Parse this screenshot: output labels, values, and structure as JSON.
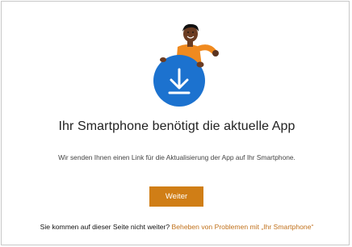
{
  "dialog": {
    "title": "Ihr Smartphone benötigt die aktuelle App",
    "subtitle": "Wir senden Ihnen einen Link für die Aktualisierung der App auf Ihr Smartphone.",
    "primary_button_label": "Weiter",
    "footer_text": "Sie kommen auf dieser Seite nicht weiter?",
    "footer_link_text": "Beheben von Problemen mit „Ihr Smartphone“",
    "illustration_icon": "download-arrow-icon"
  },
  "colors": {
    "accent_button": "#d07e16",
    "link": "#c0701a",
    "circle_blue": "#1c72cf",
    "person_shirt": "#f08a1f"
  }
}
